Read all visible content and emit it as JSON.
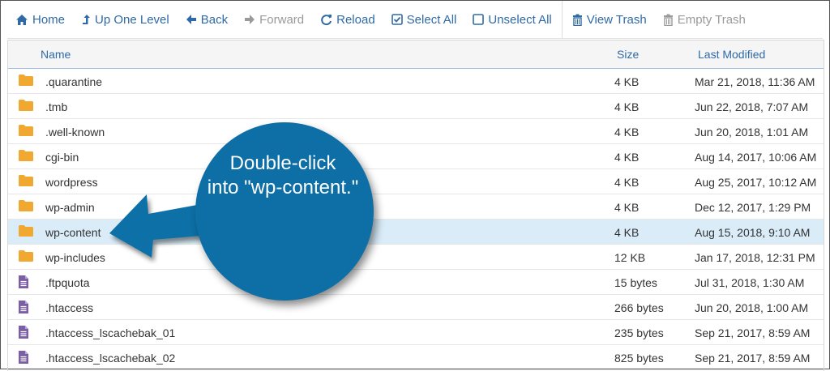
{
  "toolbar": {
    "home": "Home",
    "up": "Up One Level",
    "back": "Back",
    "forward": "Forward",
    "reload": "Reload",
    "select_all": "Select All",
    "unselect_all": "Unselect All",
    "view_trash": "View Trash",
    "empty_trash": "Empty Trash"
  },
  "columns": {
    "name": "Name",
    "size": "Size",
    "modified": "Last Modified"
  },
  "files": [
    {
      "name": ".quarantine",
      "size": "4 KB",
      "modified": "Mar 21, 2018, 11:36 AM",
      "type": "folder"
    },
    {
      "name": ".tmb",
      "size": "4 KB",
      "modified": "Jun 22, 2018, 7:07 AM",
      "type": "folder"
    },
    {
      "name": ".well-known",
      "size": "4 KB",
      "modified": "Jun 20, 2018, 1:01 AM",
      "type": "folder"
    },
    {
      "name": "cgi-bin",
      "size": "4 KB",
      "modified": "Aug 14, 2017, 10:06 AM",
      "type": "folder"
    },
    {
      "name": "wordpress",
      "size": "4 KB",
      "modified": "Aug 25, 2017, 10:12 AM",
      "type": "folder"
    },
    {
      "name": "wp-admin",
      "size": "4 KB",
      "modified": "Dec 12, 2017, 1:29 PM",
      "type": "folder"
    },
    {
      "name": "wp-content",
      "size": "4 KB",
      "modified": "Aug 15, 2018, 9:10 AM",
      "type": "folder"
    },
    {
      "name": "wp-includes",
      "size": "12 KB",
      "modified": "Jan 17, 2018, 12:31 PM",
      "type": "folder"
    },
    {
      "name": ".ftpquota",
      "size": "15 bytes",
      "modified": "Jul 31, 2018, 1:30 AM",
      "type": "file"
    },
    {
      "name": ".htaccess",
      "size": "266 bytes",
      "modified": "Jun 20, 2018, 1:00 AM",
      "type": "file"
    },
    {
      "name": ".htaccess_lscachebak_01",
      "size": "235 bytes",
      "modified": "Sep 21, 2017, 8:59 AM",
      "type": "file"
    },
    {
      "name": ".htaccess_lscachebak_02",
      "size": "825 bytes",
      "modified": "Sep 21, 2017, 8:59 AM",
      "type": "file"
    }
  ],
  "callout": {
    "line1": "Double-click",
    "line2": "into \"wp-content.\""
  },
  "colors": {
    "accent": "#2f6aa6",
    "folder": "#f0a830",
    "file": "#7a5ea6",
    "callout": "#0d6fa6",
    "selected_row": "#d9ecf8"
  }
}
